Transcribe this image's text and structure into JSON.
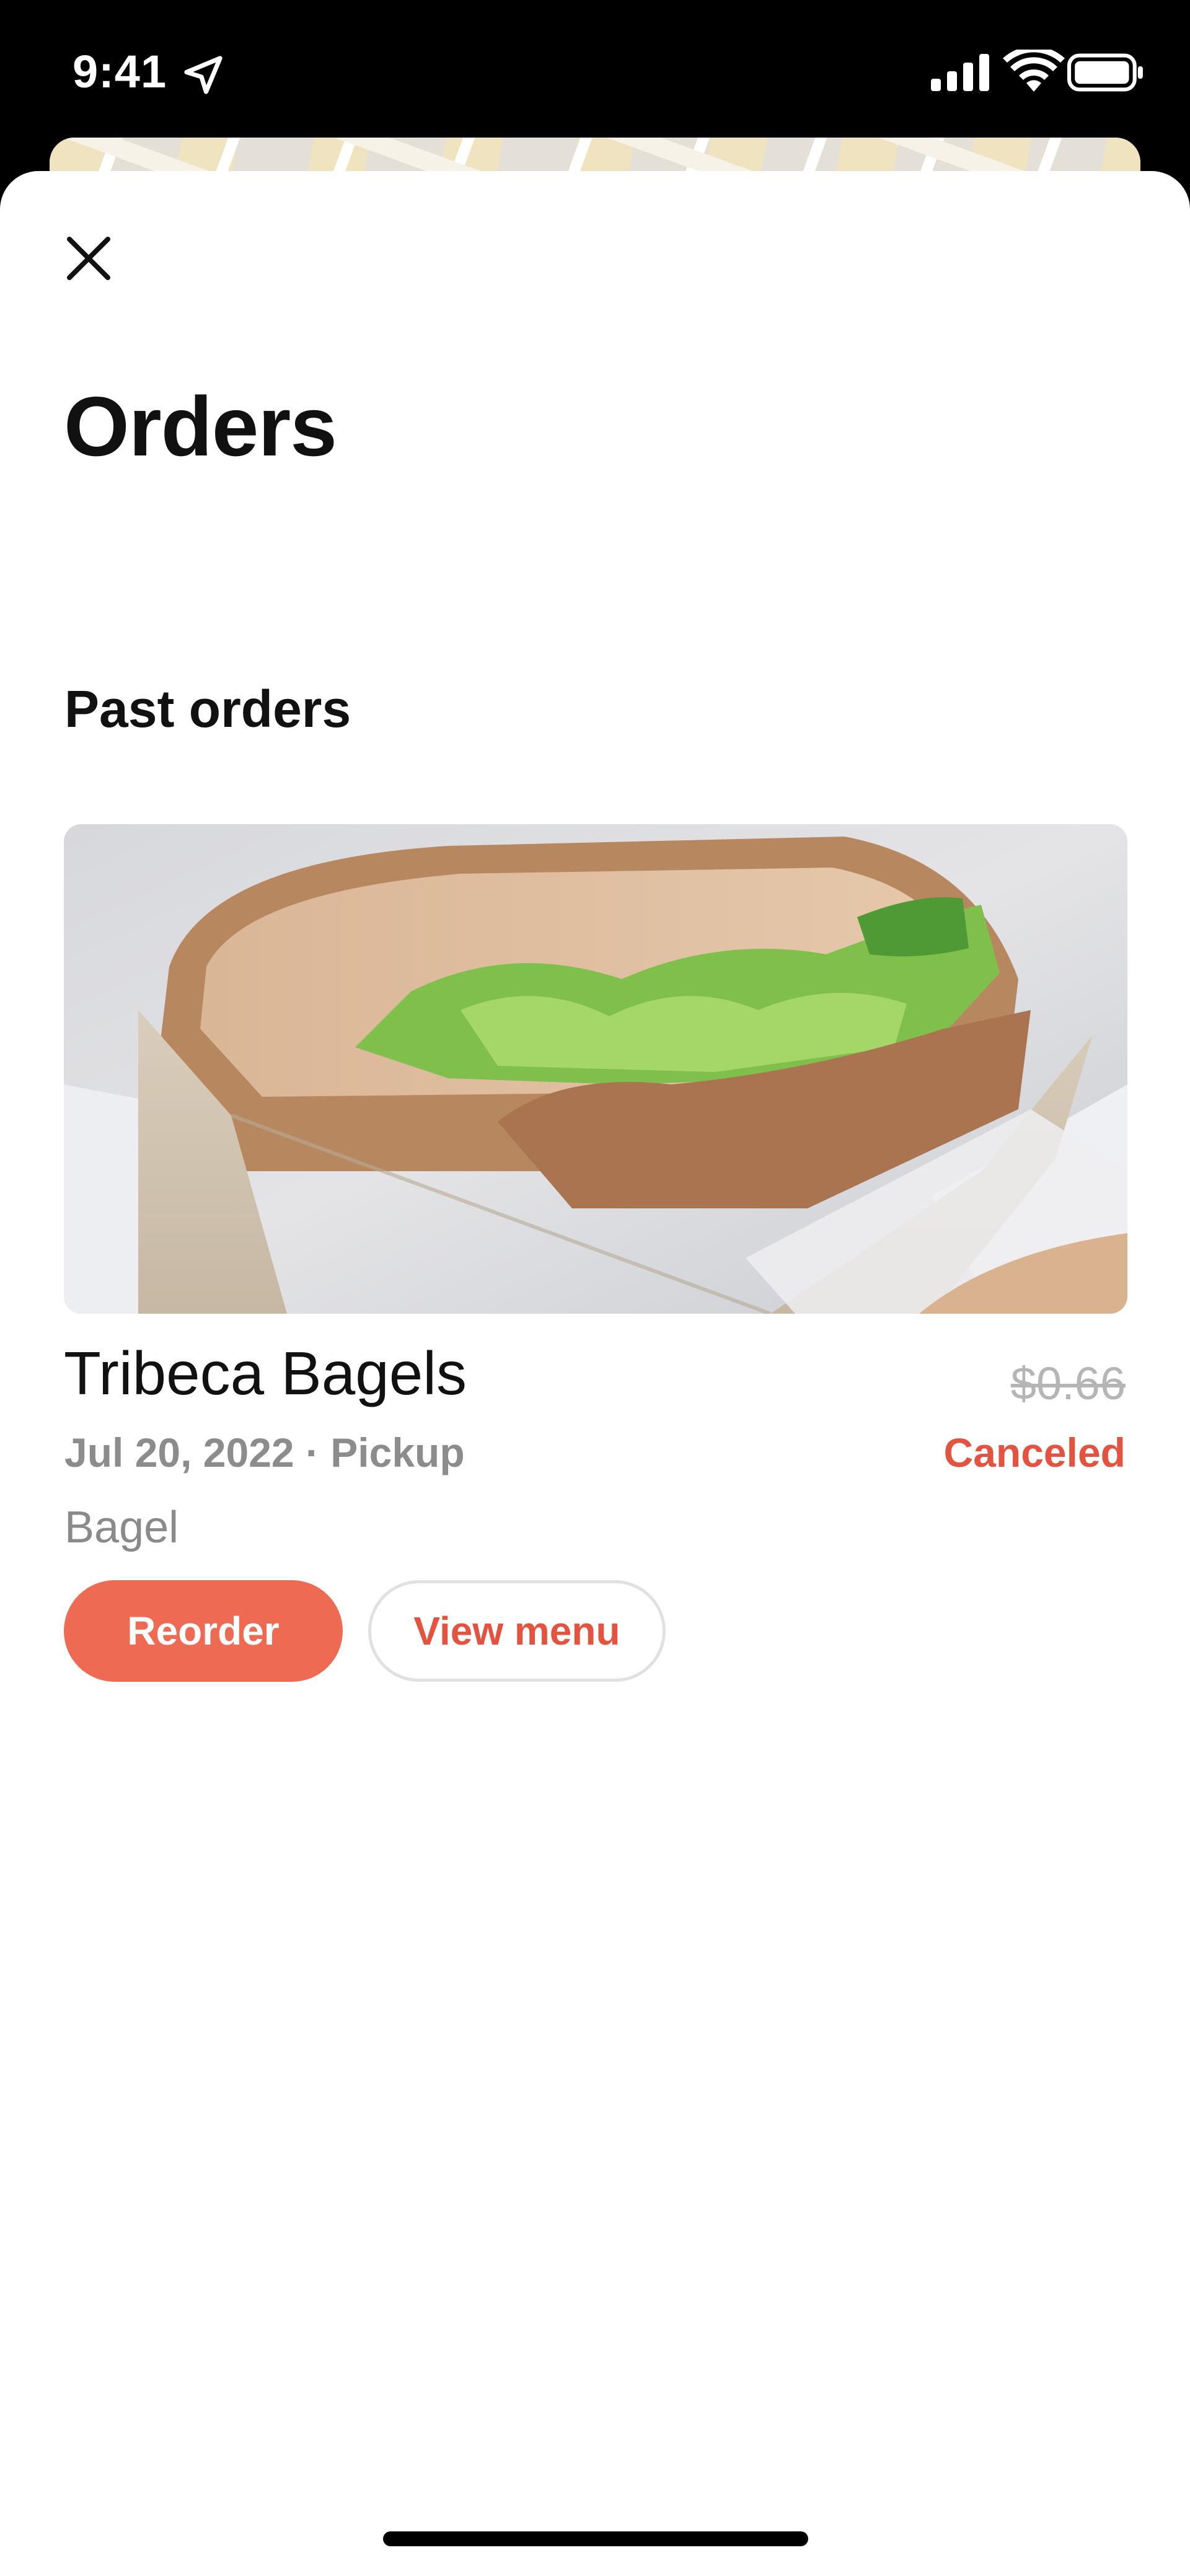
{
  "status_bar": {
    "time": "9:41",
    "icons": [
      "location-arrow-icon",
      "cellular-signal-icon",
      "wifi-icon",
      "battery-icon"
    ]
  },
  "header": {
    "close_icon": "close-icon",
    "title": "Orders"
  },
  "section": {
    "title": "Past orders"
  },
  "order": {
    "image": "sandwich-photo",
    "store_name": "Tribeca Bagels",
    "price": "$0.66",
    "date_type": "Jul 20, 2022 · Pickup",
    "status": "Canceled",
    "items": "Bagel",
    "reorder_label": "Reorder",
    "view_menu_label": "View menu"
  },
  "colors": {
    "accent": "#ee6a52",
    "status_canceled": "#e3533f",
    "muted_text": "#8c8c8c",
    "strikethrough_price": "#b5b5b5"
  }
}
